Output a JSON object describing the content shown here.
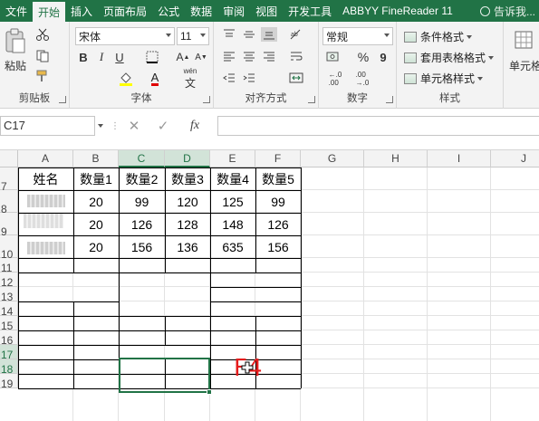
{
  "tabs": [
    {
      "label": "文件",
      "active": false
    },
    {
      "label": "开始",
      "active": true
    },
    {
      "label": "插入",
      "active": false
    },
    {
      "label": "页面布局",
      "active": false
    },
    {
      "label": "公式",
      "active": false
    },
    {
      "label": "数据",
      "active": false
    },
    {
      "label": "审阅",
      "active": false
    },
    {
      "label": "视图",
      "active": false
    },
    {
      "label": "开发工具",
      "active": false
    },
    {
      "label": "ABBYY FineReader 11",
      "active": false
    }
  ],
  "tell_me": "告诉我...",
  "ribbon": {
    "clipboard": {
      "paste_label": "粘贴",
      "group_label": "剪贴板"
    },
    "font": {
      "font_name": "宋体",
      "font_size": "11",
      "group_label": "字体",
      "pinyin_label": "wén"
    },
    "alignment": {
      "group_label": "对齐方式"
    },
    "number": {
      "format": "常规",
      "percent": "%",
      "comma": "9",
      "group_label": "数字"
    },
    "styles": {
      "conditional": "条件格式",
      "table": "套用表格格式",
      "cell_styles": "单元格样式",
      "group_label": "样式"
    },
    "cells": {
      "label": "单元格"
    }
  },
  "formula_bar": {
    "name_box": "C17",
    "formula": "",
    "fx": "fx"
  },
  "columns": [
    "A",
    "B",
    "C",
    "D",
    "E",
    "F",
    "G",
    "H",
    "I",
    "J"
  ],
  "selected_columns": [
    "C",
    "D"
  ],
  "rows": [
    "7",
    "8",
    "9",
    "10",
    "11",
    "12",
    "13",
    "14",
    "15",
    "16",
    "17",
    "18",
    "19"
  ],
  "selected_rows": [
    "17",
    "18"
  ],
  "table": {
    "headers": [
      "姓名",
      "数量1",
      "数量2",
      "数量3",
      "数量4",
      "数量5"
    ],
    "data": [
      [
        "20",
        "99",
        "120",
        "125",
        "99"
      ],
      [
        "20",
        "126",
        "128",
        "148",
        "126"
      ],
      [
        "20",
        "156",
        "136",
        "635",
        "156"
      ]
    ]
  },
  "overlay_text": "F4",
  "colors": {
    "accent": "#217346",
    "overlay": "#e51c1c"
  }
}
